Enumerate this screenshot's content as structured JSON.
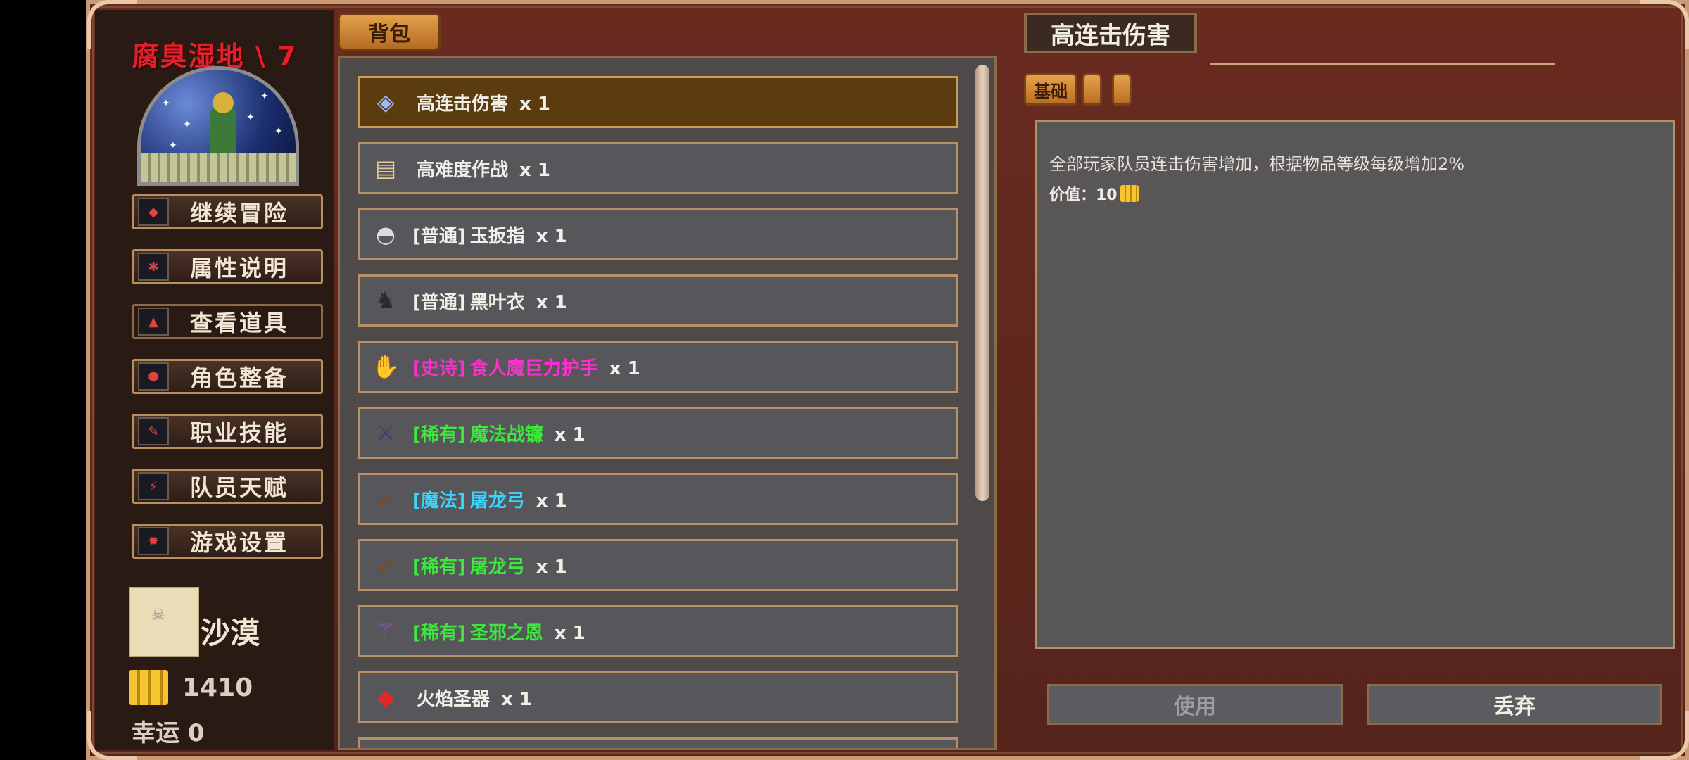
{
  "sidebar": {
    "location_title": "腐臭湿地 \\ 7",
    "menu": [
      {
        "label": "继续冒险",
        "icon": "adventure-icon"
      },
      {
        "label": "属性说明",
        "icon": "attributes-icon"
      },
      {
        "label": "查看道具",
        "icon": "items-icon",
        "active": true
      },
      {
        "label": "角色整备",
        "icon": "character-icon"
      },
      {
        "label": "职业技能",
        "icon": "skills-icon"
      },
      {
        "label": "队员天赋",
        "icon": "talent-icon"
      },
      {
        "label": "游戏设置",
        "icon": "settings-icon"
      }
    ],
    "region_name": "沙漠",
    "gold": "1410",
    "luck": "幸运 0"
  },
  "bag": {
    "tab_label": "背包",
    "items": [
      {
        "tag": "",
        "name": "高连击伤害",
        "qty": "x 1",
        "rarity": "common",
        "icon": "gem-icon",
        "selected": true
      },
      {
        "tag": "",
        "name": "高难度作战",
        "qty": "x 1",
        "rarity": "common",
        "icon": "scroll-icon"
      },
      {
        "tag": "[普通]",
        "name": "玉扳指",
        "qty": "x 1",
        "rarity": "common",
        "icon": "ring-icon"
      },
      {
        "tag": "[普通]",
        "name": "黑叶衣",
        "qty": "x 1",
        "rarity": "common",
        "icon": "armor-icon"
      },
      {
        "tag": "[史诗]",
        "name": "食人魔巨力护手",
        "qty": "x 1",
        "rarity": "epic",
        "icon": "gauntlet-icon"
      },
      {
        "tag": "[稀有]",
        "name": "魔法战镰",
        "qty": "x 1",
        "rarity": "rare",
        "icon": "scythe-icon"
      },
      {
        "tag": "[魔法]",
        "name": "屠龙弓",
        "qty": "x 1",
        "rarity": "magic",
        "icon": "bow-icon"
      },
      {
        "tag": "[稀有]",
        "name": "屠龙弓",
        "qty": "x 1",
        "rarity": "rare",
        "icon": "bow-icon"
      },
      {
        "tag": "[稀有]",
        "name": "圣邪之恩",
        "qty": "x 1",
        "rarity": "rare",
        "icon": "wand-icon"
      },
      {
        "tag": "",
        "name": "火焰圣器",
        "qty": "x 1",
        "rarity": "common",
        "icon": "relic-icon"
      }
    ]
  },
  "detail": {
    "title": "高连击伤害",
    "tab_label": "基础",
    "description": "全部玩家队员连击伤害增加，根据物品等级每级增加2%",
    "value_label": "价值：10",
    "use_label": "使用",
    "discard_label": "丢弃"
  },
  "colors": {
    "common": "#f2efe8",
    "epic": "#ff2ed0",
    "rare": "#3be83b",
    "magic": "#39d5ff",
    "location_red": "#e3202a"
  }
}
